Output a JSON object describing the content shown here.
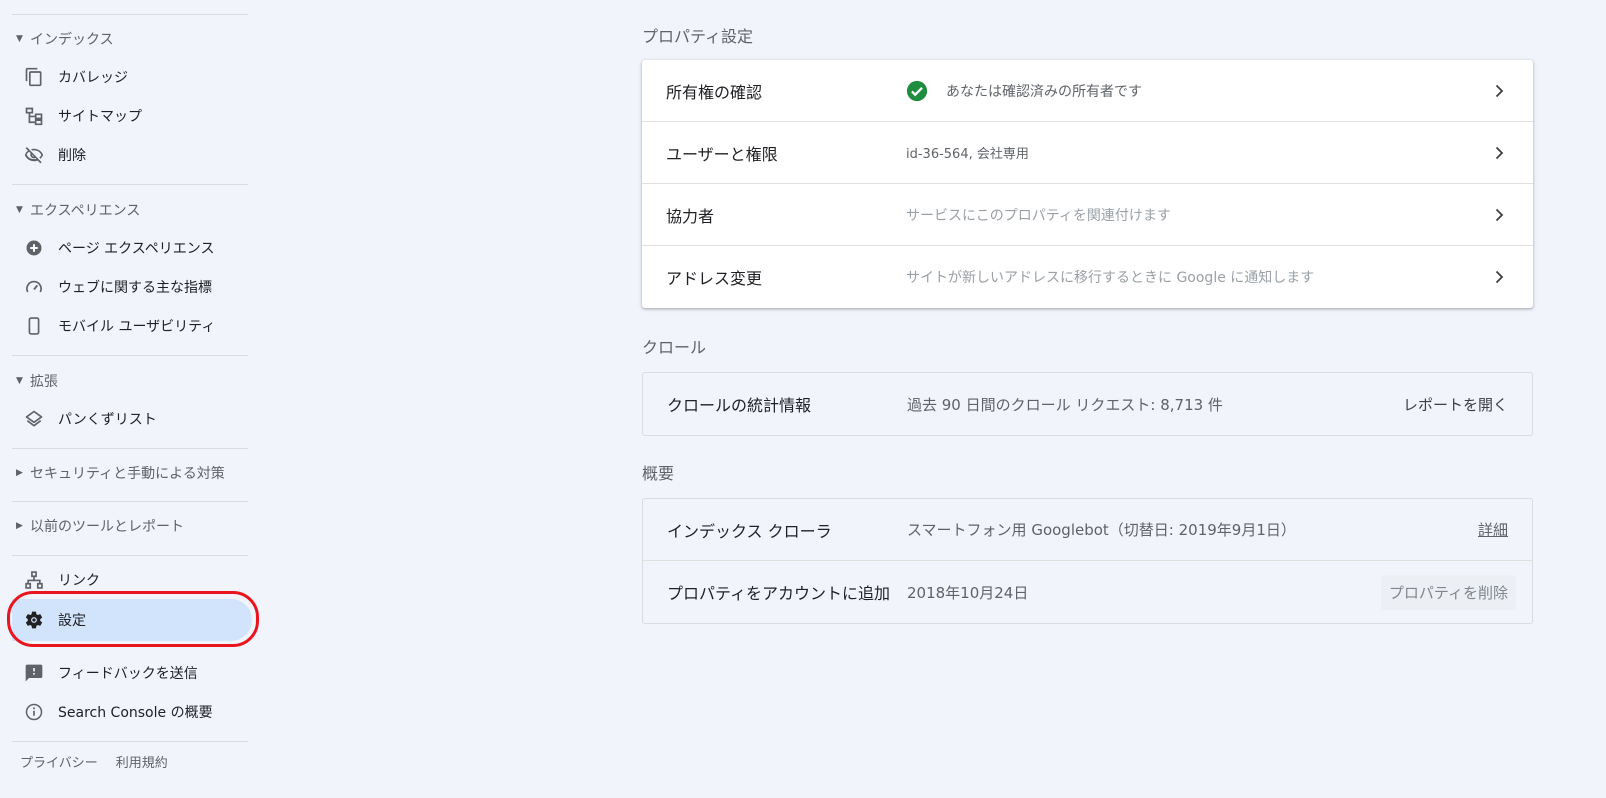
{
  "sidebar": {
    "sections": [
      {
        "label": "インデックス",
        "items": [
          {
            "label": "カバレッジ",
            "icon": "copy-icon"
          },
          {
            "label": "サイトマップ",
            "icon": "sitemap-icon"
          },
          {
            "label": "削除",
            "icon": "eye-off-icon"
          }
        ]
      },
      {
        "label": "エクスペリエンス",
        "items": [
          {
            "label": "ページ エクスペリエンス",
            "icon": "plus-circle-icon"
          },
          {
            "label": "ウェブに関する主な指標",
            "icon": "speedometer-icon"
          },
          {
            "label": "モバイル ユーザビリティ",
            "icon": "phone-icon"
          }
        ]
      },
      {
        "label": "拡張",
        "items": [
          {
            "label": "パンくずリスト",
            "icon": "layers-icon"
          }
        ]
      },
      {
        "label": "セキュリティと手動による対策"
      },
      {
        "label": "以前のツールとレポート"
      }
    ],
    "links": {
      "label": "リンク",
      "icon": "network-icon"
    },
    "settings": {
      "label": "設定",
      "icon": "gear-icon"
    },
    "feedback": {
      "label": "フィードバックを送信",
      "icon": "feedback-icon"
    },
    "about": {
      "label": "Search Console の概要",
      "icon": "info-icon"
    },
    "footer": {
      "privacy": "プライバシー",
      "terms": "利用規約"
    },
    "highlight_color": "#e8151f"
  },
  "property_settings": {
    "title": "プロパティ設定",
    "rows": [
      {
        "label": "所有権の確認",
        "value": "あなたは確認済みの所有者です"
      },
      {
        "label": "ユーザーと権限",
        "value": "id-36-564, 会社専用"
      },
      {
        "label": "協力者",
        "value": "サービスにこのプロパティを関連付けます"
      },
      {
        "label": "アドレス変更",
        "value": "サイトが新しいアドレスに移行するときに Google に通知します"
      }
    ]
  },
  "crawl": {
    "title": "クロール",
    "label": "クロールの統計情報",
    "value": "過去 90 日間のクロール リクエスト: 8,713 件",
    "action": "レポートを開く"
  },
  "overview": {
    "title": "概要",
    "rows": [
      {
        "label": "インデックス クローラ",
        "value": "スマートフォン用 Googlebot（切替日: 2019年9月1日）",
        "action": "詳細"
      },
      {
        "label": "プロパティをアカウントに追加",
        "value": "2018年10月24日",
        "action": "プロパティを削除"
      }
    ]
  },
  "colors": {
    "verified_green": "#1e8e3e",
    "active_bg": "#d2e3fc",
    "page_bg": "#f1f4fb"
  }
}
